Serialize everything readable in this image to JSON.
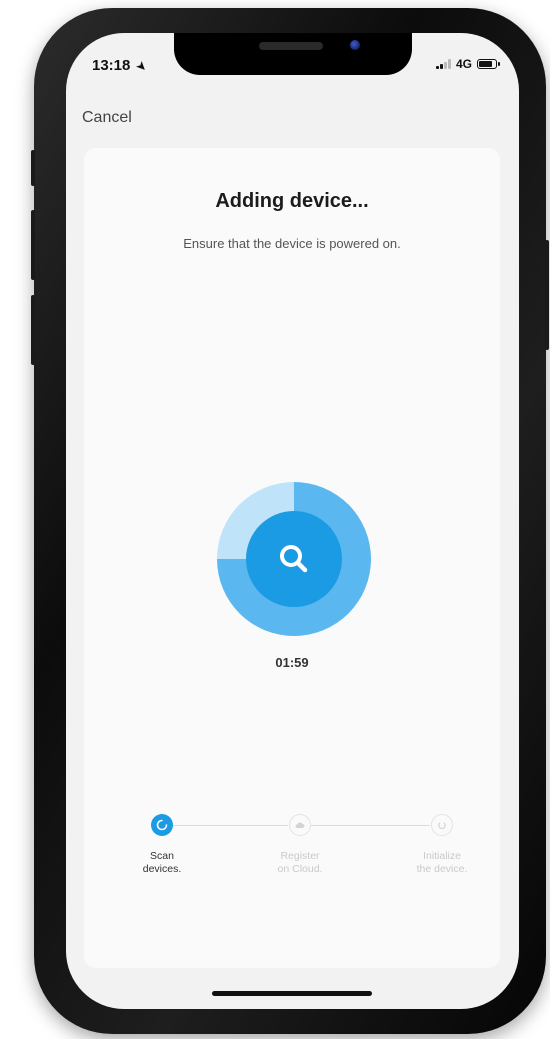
{
  "status_bar": {
    "time": "13:18",
    "network": "4G"
  },
  "nav": {
    "cancel_label": "Cancel"
  },
  "main": {
    "title": "Adding device...",
    "subtitle": "Ensure that the device is powered on.",
    "timer": "01:59",
    "scan_icon": "search-icon",
    "progress_fraction": 0.75
  },
  "steps": [
    {
      "label": "Scan\ndevices.",
      "state": "active",
      "icon": "spinner-icon"
    },
    {
      "label": "Register\non Cloud.",
      "state": "pending",
      "icon": "cloud-icon"
    },
    {
      "label": "Initialize\nthe device.",
      "state": "pending",
      "icon": "power-icon"
    }
  ],
  "colors": {
    "accent": "#1b9be4",
    "accent_light": "#5ab7ef",
    "accent_pale": "#bfe3f8"
  }
}
